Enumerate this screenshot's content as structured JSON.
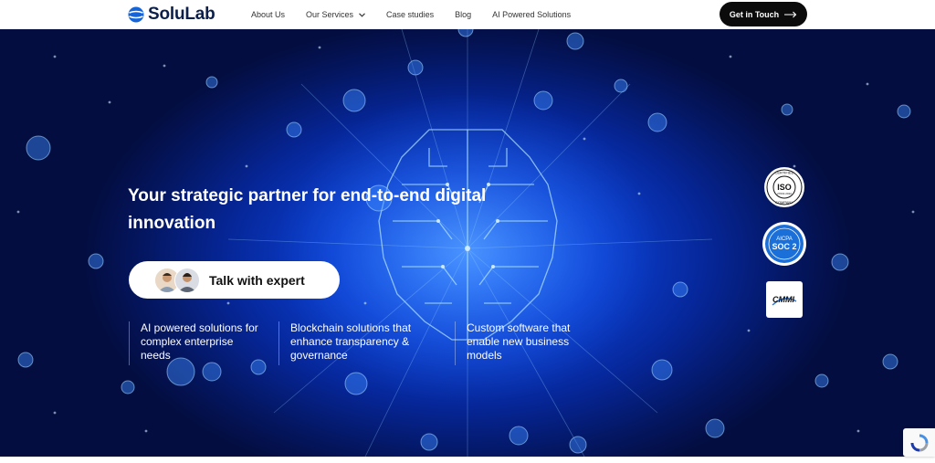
{
  "brand": {
    "name": "SoluLab"
  },
  "nav": {
    "items": [
      {
        "label": "About Us",
        "dropdown": false
      },
      {
        "label": "Our Services",
        "dropdown": true
      },
      {
        "label": "Case studies",
        "dropdown": false
      },
      {
        "label": "Blog",
        "dropdown": false
      },
      {
        "label": "AI Powered Solutions",
        "dropdown": false
      }
    ],
    "cta_label": "Get in Touch"
  },
  "hero": {
    "headline": "Your strategic partner for end-to-end digital innovation",
    "talk_label": "Talk with expert",
    "columns": [
      "AI powered solutions for complex enterprise needs",
      "Blockchain solutions that enhance transparency & governance",
      "Custom software that enable new business models"
    ]
  },
  "badges": {
    "iso": {
      "top": "CERTIFIED",
      "main": "ISO",
      "sub": "27001:2022",
      "bottom": "COMPANY"
    },
    "soc": {
      "top": "AICPA",
      "main": "SOC 2"
    },
    "cmmi": {
      "main": "CMMI"
    }
  },
  "colors": {
    "hero_bg": "#0b3fd0",
    "cta_bg": "#0b0b0b",
    "brand_blue": "#1565d8",
    "text_dark": "#0b1f4a"
  }
}
